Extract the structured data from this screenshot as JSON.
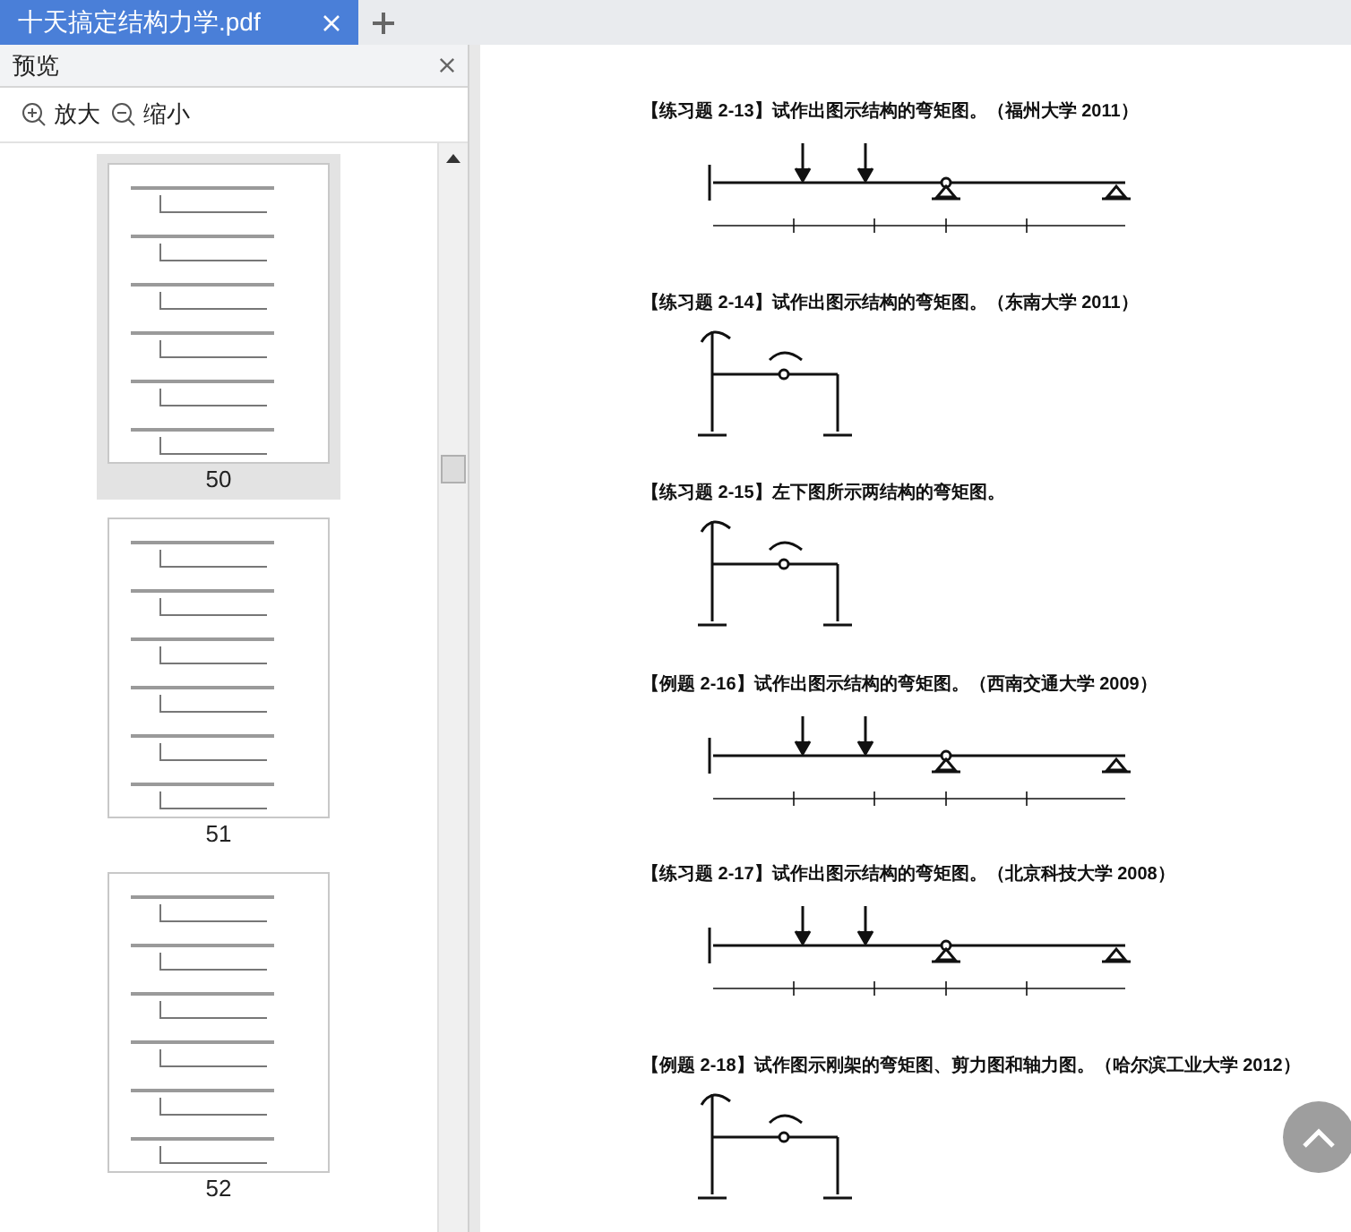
{
  "tabs": [
    {
      "label": "十天搞定结构力学.pdf",
      "selected": true
    }
  ],
  "preview_panel": {
    "title": "预览",
    "zoom_in": "放大",
    "zoom_out": "缩小",
    "thumbnails": [
      {
        "page": "50",
        "selected": true
      },
      {
        "page": "51",
        "selected": false
      },
      {
        "page": "52",
        "selected": false
      }
    ]
  },
  "document": {
    "problems": [
      {
        "heading": "【练习题 2-13】试作出图示结构的弯矩图。（福州大学 2011）",
        "kind": "beam"
      },
      {
        "heading": "【练习题 2-14】试作出图示结构的弯矩图。（东南大学 2011）",
        "kind": "frame"
      },
      {
        "heading": "【练习题 2-15】左下图所示两结构的弯矩图。",
        "kind": "frame"
      },
      {
        "heading": "【例题 2-16】试作出图示结构的弯矩图。（西南交通大学 2009）",
        "kind": "beam"
      },
      {
        "heading": "【练习题 2-17】试作出图示结构的弯矩图。（北京科技大学 2008）",
        "kind": "beam"
      },
      {
        "heading": "【例题 2-18】试作图示刚架的弯矩图、剪力图和轴力图。（哈尔滨工业大学 2012）",
        "kind": "frame"
      }
    ]
  }
}
